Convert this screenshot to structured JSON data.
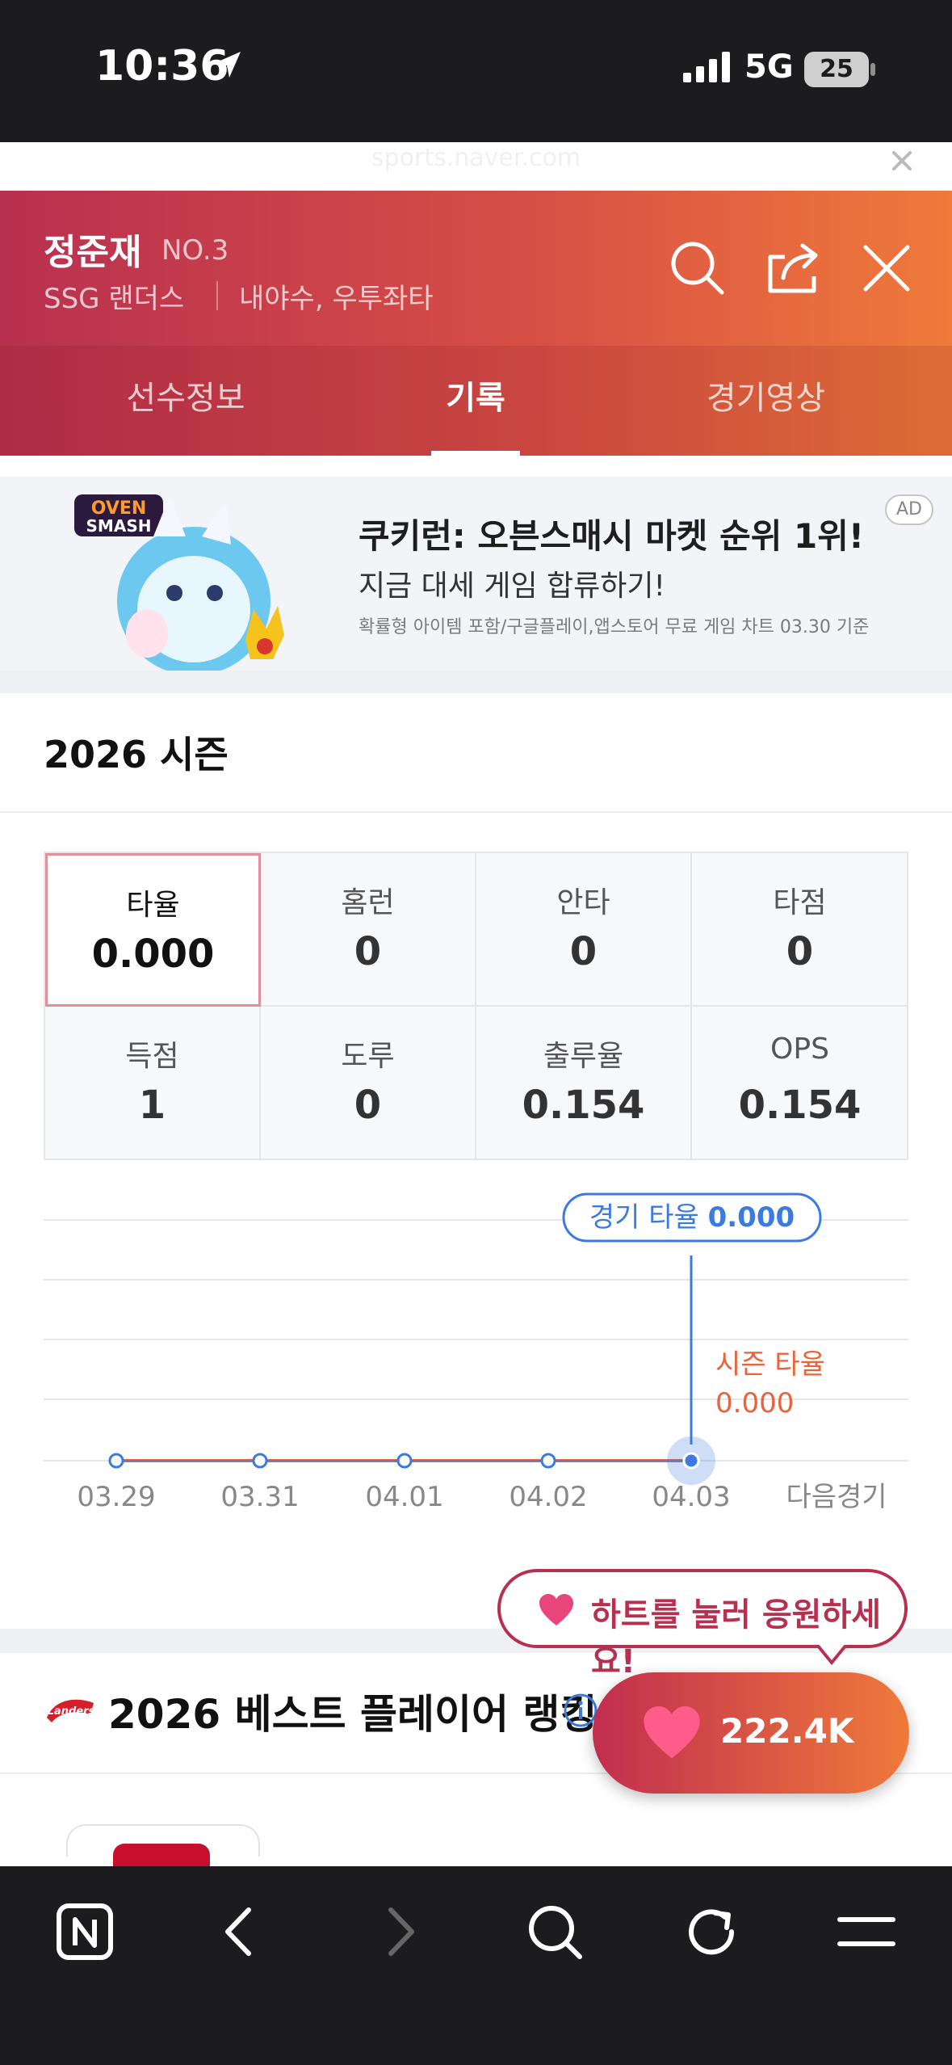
{
  "status_bar": {
    "time": "10:36",
    "network": "5G",
    "battery": "25"
  },
  "browser": {
    "url": "sports.naver.com"
  },
  "header": {
    "player_name": "정준재",
    "player_no": "NO.3",
    "team": "SSG 랜더스",
    "position": "내야수, 우투좌타",
    "tabs": [
      {
        "label": "선수정보"
      },
      {
        "label": "기록",
        "active": true
      },
      {
        "label": "경기영상"
      }
    ]
  },
  "ad": {
    "headline": "쿠키런: 오븐스매시 마켓 순위 1위!",
    "subline": "지금 대세 게임 합류하기!",
    "disclaimer": "확률형 아이템 포함/구글플레이,앱스토어 무료 게임 차트 03.30 기준",
    "badge": "AD"
  },
  "season": {
    "title": "2026 시즌",
    "stats": [
      {
        "label": "타율",
        "value": "0.000",
        "selected": true
      },
      {
        "label": "홈런",
        "value": "0"
      },
      {
        "label": "안타",
        "value": "0"
      },
      {
        "label": "타점",
        "value": "0"
      },
      {
        "label": "득점",
        "value": "1"
      },
      {
        "label": "도루",
        "value": "0"
      },
      {
        "label": "출루율",
        "value": "0.154"
      },
      {
        "label": "OPS",
        "value": "0.154"
      }
    ]
  },
  "chart_data": {
    "type": "line",
    "categories": [
      "03.29",
      "03.31",
      "04.01",
      "04.02",
      "04.03",
      "다음경기"
    ],
    "series": [
      {
        "name": "경기 타율",
        "values": [
          0,
          0,
          0,
          0,
          0
        ]
      },
      {
        "name": "시즌 타율",
        "values": [
          0,
          0,
          0,
          0,
          0
        ]
      }
    ],
    "tooltip_label": "경기 타율",
    "tooltip_value": "0.000",
    "season_label": "시즌 타율",
    "season_value": "0.000",
    "colors": {
      "game": "#3b7be0",
      "season": "#e8643c"
    }
  },
  "cheer": {
    "bubble_text": "하트를 눌러 응원하세요!",
    "count": "222.4K"
  },
  "ranking": {
    "title": "2026 베스트 플레이어 랭킹"
  }
}
